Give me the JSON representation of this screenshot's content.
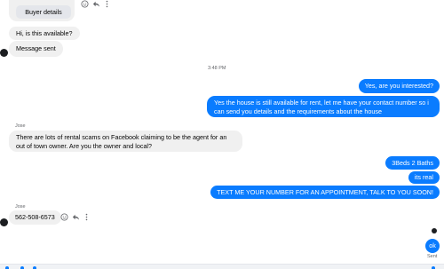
{
  "header": {
    "buyer_details_label": "Buyer details"
  },
  "messages": {
    "m1": "Hi, is this available?",
    "m2": "Message sent",
    "time_separator": "3:48 PM",
    "m3": "Yes, are you interested?",
    "m4": "Yes the house is still available for rent, let me have your contact number so i can send you details and the requirements about the house",
    "sender_a": "Jose",
    "m5": "There are lots of rental scams on Facebook claiming to be the agent for an out of town owner. Are you the owner and local?",
    "m6": "3Beds 2 Baths",
    "m7": "its real",
    "m8": "TEXT ME YOUR NUMBER FOR AN APPOINTMENT, TALK TO YOU SOON!",
    "sender_b": "Jose",
    "m9": "562-508-6573",
    "m10": "ok",
    "status": "Sent"
  },
  "icons": [
    "smiley-icon",
    "reply-icon",
    "more-icon"
  ],
  "colors": {
    "outgoing": "#0a7cff",
    "incoming": "#f0f0f0",
    "secondary_text": "#65676b"
  }
}
